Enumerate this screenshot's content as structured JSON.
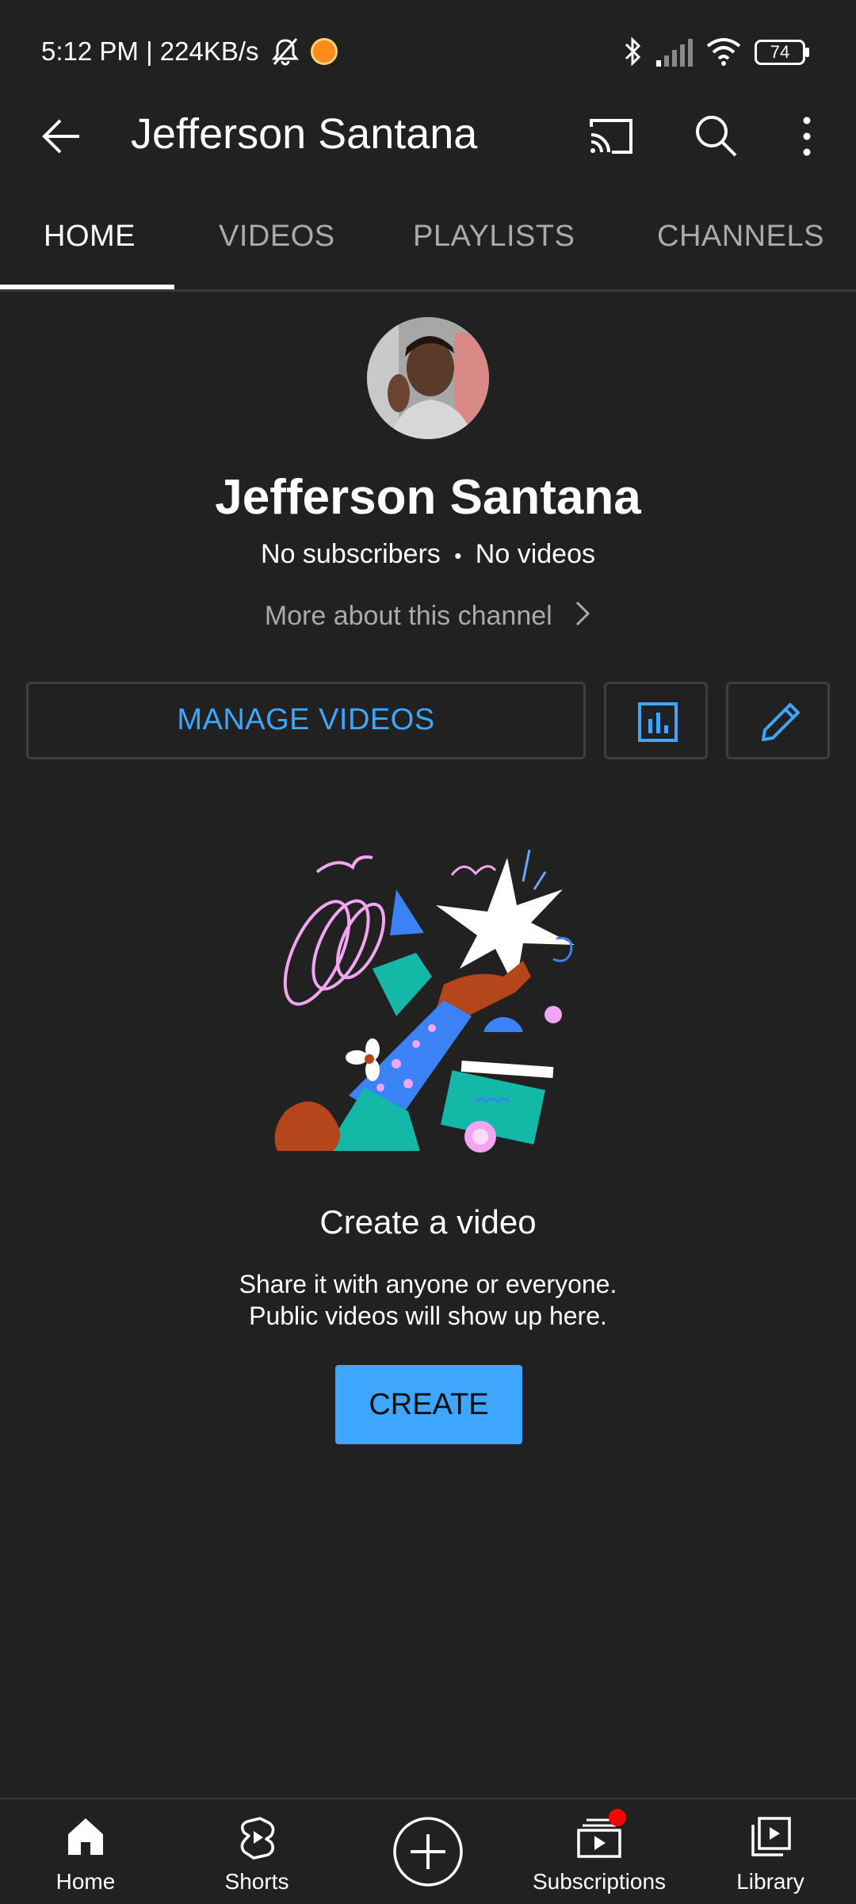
{
  "status_bar": {
    "time_speed": "5:12 PM | 224KB/s",
    "battery": "74"
  },
  "app_bar": {
    "title": "Jefferson Santana",
    "icons": [
      "back-arrow-icon",
      "cast-icon",
      "search-icon",
      "more-vert-icon"
    ]
  },
  "tabs": [
    {
      "label": "HOME",
      "active": true
    },
    {
      "label": "VIDEOS",
      "active": false
    },
    {
      "label": "PLAYLISTS",
      "active": false
    },
    {
      "label": "CHANNELS",
      "active": false
    }
  ],
  "channel": {
    "name": "Jefferson Santana",
    "subscribers": "No subscribers",
    "separator": "•",
    "videos": "No videos",
    "more_about": "More about this channel"
  },
  "actions": {
    "manage_videos": "MANAGE VIDEOS",
    "analytics_icon": "analytics-icon",
    "edit_icon": "edit-pencil-icon"
  },
  "empty_state": {
    "title": "Create a video",
    "line1": "Share it with anyone or everyone.",
    "line2": "Public videos will show up here.",
    "button": "CREATE"
  },
  "bottom_nav": [
    {
      "label": "Home",
      "icon": "home-icon"
    },
    {
      "label": "Shorts",
      "icon": "shorts-icon"
    },
    {
      "label": "",
      "icon": "create-plus-icon"
    },
    {
      "label": "Subscriptions",
      "icon": "subscriptions-icon"
    },
    {
      "label": "Library",
      "icon": "library-icon"
    }
  ],
  "colors": {
    "background": "#212121",
    "accent_blue": "#3ea6ff",
    "notification_dot": "#ff0000"
  }
}
